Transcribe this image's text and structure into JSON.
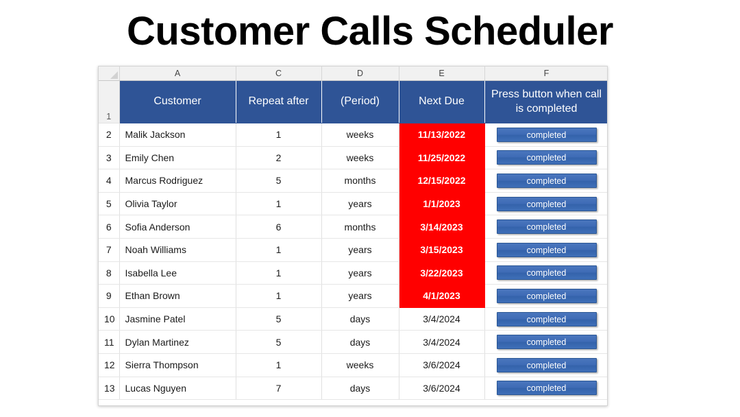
{
  "page": {
    "title": "Customer Calls Scheduler"
  },
  "spreadsheet": {
    "corner_icon": "select-all-triangle-icon",
    "column_letters": [
      "A",
      "C",
      "D",
      "E",
      "F"
    ],
    "header_row_number": "1",
    "headers": {
      "customer": "Customer",
      "repeat_after": "Repeat after",
      "period": "(Period)",
      "next_due": "Next Due",
      "action": "Press button when call is completed"
    },
    "colors": {
      "header_blue": "#2F5496",
      "overdue_red": "#FF0000",
      "button_blue": "#3F6CB6",
      "gutter_gray": "#F1F1F1"
    },
    "button_label": "completed",
    "rows": [
      {
        "row": "2",
        "customer": "Malik Jackson",
        "repeat": "1",
        "period": "weeks",
        "due": "11/13/2022",
        "overdue": true
      },
      {
        "row": "3",
        "customer": "Emily Chen",
        "repeat": "2",
        "period": "weeks",
        "due": "11/25/2022",
        "overdue": true
      },
      {
        "row": "4",
        "customer": "Marcus Rodriguez",
        "repeat": "5",
        "period": "months",
        "due": "12/15/2022",
        "overdue": true
      },
      {
        "row": "5",
        "customer": "Olivia Taylor",
        "repeat": "1",
        "period": "years",
        "due": "1/1/2023",
        "overdue": true
      },
      {
        "row": "6",
        "customer": "Sofia Anderson",
        "repeat": "6",
        "period": "months",
        "due": "3/14/2023",
        "overdue": true
      },
      {
        "row": "7",
        "customer": "Noah Williams",
        "repeat": "1",
        "period": "years",
        "due": "3/15/2023",
        "overdue": true
      },
      {
        "row": "8",
        "customer": "Isabella Lee",
        "repeat": "1",
        "period": "years",
        "due": "3/22/2023",
        "overdue": true
      },
      {
        "row": "9",
        "customer": "Ethan Brown",
        "repeat": "1",
        "period": "years",
        "due": "4/1/2023",
        "overdue": true
      },
      {
        "row": "10",
        "customer": "Jasmine Patel",
        "repeat": "5",
        "period": "days",
        "due": "3/4/2024",
        "overdue": false
      },
      {
        "row": "11",
        "customer": "Dylan Martinez",
        "repeat": "5",
        "period": "days",
        "due": "3/4/2024",
        "overdue": false
      },
      {
        "row": "12",
        "customer": "Sierra Thompson",
        "repeat": "1",
        "period": "weeks",
        "due": "3/6/2024",
        "overdue": false
      },
      {
        "row": "13",
        "customer": "Lucas Nguyen",
        "repeat": "7",
        "period": "days",
        "due": "3/6/2024",
        "overdue": false
      }
    ]
  }
}
